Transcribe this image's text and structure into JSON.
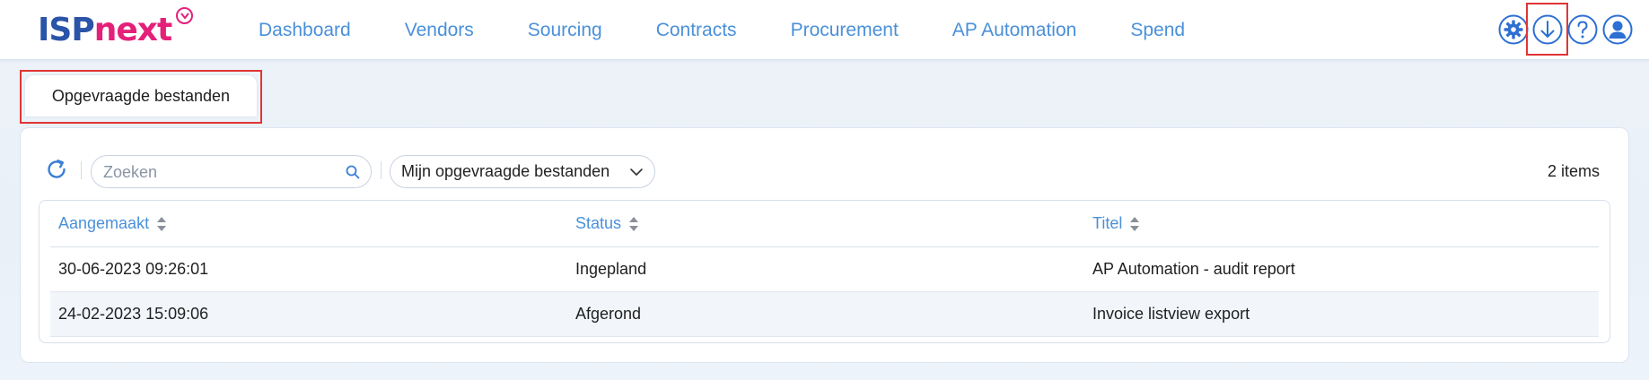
{
  "app": {
    "logo_part1": "ISP",
    "logo_part2": "next"
  },
  "nav": {
    "items": [
      "Dashboard",
      "Vendors",
      "Sourcing",
      "Contracts",
      "Procurement",
      "AP Automation",
      "Spend"
    ]
  },
  "header_icons": [
    "gear-icon",
    "download-icon",
    "help-icon",
    "user-icon"
  ],
  "tab": {
    "label": "Opgevraagde bestanden"
  },
  "toolbar": {
    "search_placeholder": "Zoeken",
    "filter_selected": "Mijn opgevraagde bestanden",
    "items_count": "2 items"
  },
  "table": {
    "columns": [
      "Aangemaakt",
      "Status",
      "Titel"
    ],
    "rows": [
      {
        "created": "30-06-2023 09:26:01",
        "status": "Ingepland",
        "title": "AP Automation - audit report"
      },
      {
        "created": "24-02-2023 15:09:06",
        "status": "Afgerond",
        "title": "Invoice listview export"
      }
    ]
  },
  "colors": {
    "accent": "#4a90d9",
    "brand_blue": "#2a54a8",
    "brand_pink": "#e4207a",
    "highlight": "#e03535"
  }
}
